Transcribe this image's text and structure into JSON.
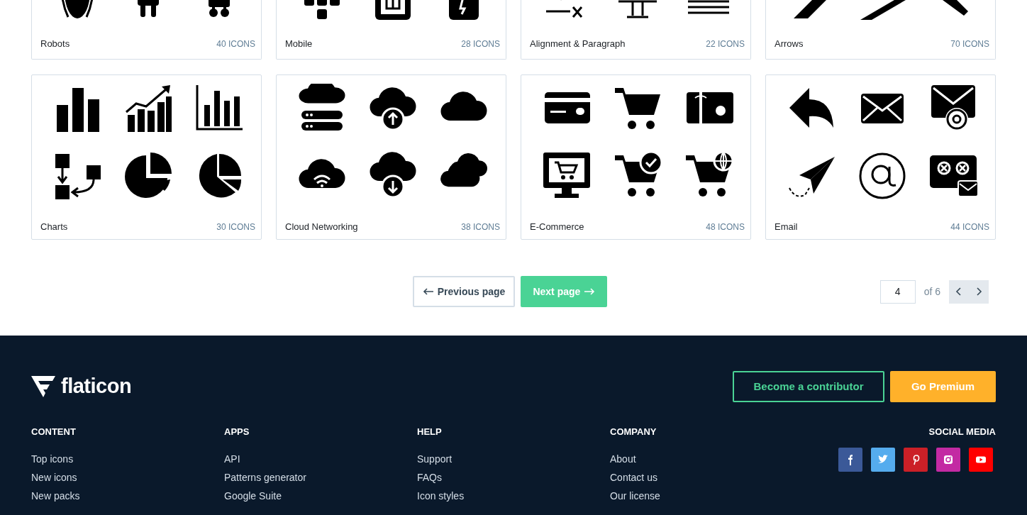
{
  "packs": [
    {
      "name": "Robots",
      "count": "40 ICONS"
    },
    {
      "name": "Mobile",
      "count": "28 ICONS"
    },
    {
      "name": "Alignment & Paragraph",
      "count": "22 ICONS"
    },
    {
      "name": "Arrows",
      "count": "70 ICONS"
    },
    {
      "name": "Charts",
      "count": "30 ICONS"
    },
    {
      "name": "Cloud Networking",
      "count": "38 ICONS"
    },
    {
      "name": "E-Commerce",
      "count": "48 ICONS"
    },
    {
      "name": "Email",
      "count": "44 ICONS"
    }
  ],
  "pagination": {
    "previous": "Previous page",
    "next": "Next page",
    "page": "4",
    "total": "of 6"
  },
  "footer": {
    "logo": "flaticon",
    "buttons": [
      {
        "label": "Become a contributor",
        "kind": "outline"
      },
      {
        "label": "Go Premium",
        "kind": "solid"
      }
    ],
    "columns": [
      {
        "heading": "CONTENT",
        "links": [
          "Top icons",
          "New icons",
          "New packs"
        ]
      },
      {
        "heading": "APPS",
        "links": [
          "API",
          "Patterns generator",
          "Google Suite"
        ]
      },
      {
        "heading": "HELP",
        "links": [
          "Support",
          "FAQs",
          "Icon styles"
        ]
      },
      {
        "heading": "COMPANY",
        "links": [
          "About",
          "Contact us",
          "Our license"
        ]
      }
    ],
    "social": {
      "heading": "SOCIAL MEDIA",
      "networks": [
        {
          "kind": "facebook",
          "color": "#3b5998"
        },
        {
          "kind": "twitter",
          "color": "#55acee"
        },
        {
          "kind": "pinterest",
          "color": "#cb2027"
        },
        {
          "kind": "instagram",
          "color": "#c32aa3"
        },
        {
          "kind": "youtube",
          "color": "#ff0000"
        }
      ]
    }
  }
}
